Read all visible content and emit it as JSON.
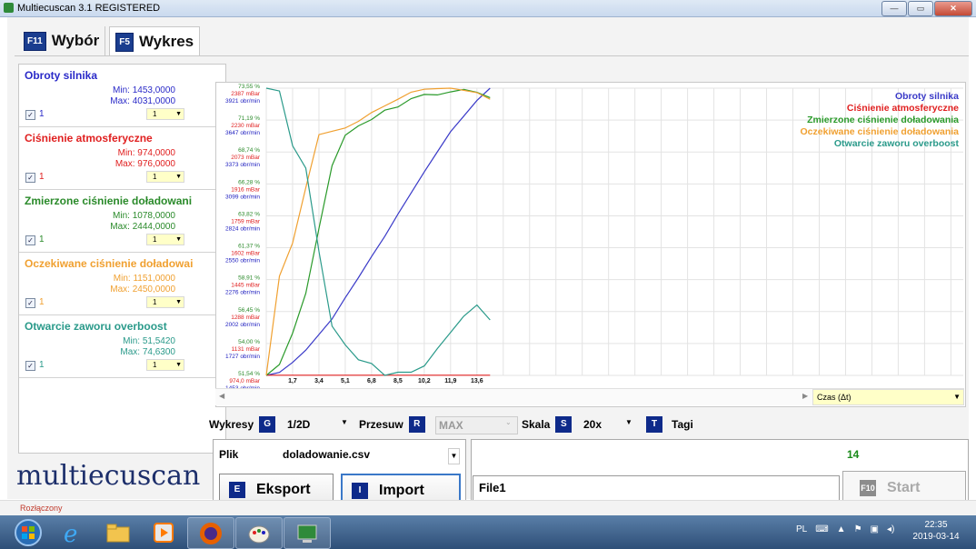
{
  "window": {
    "title": "Multiecuscan 3.1 REGISTERED",
    "buttons": [
      "—",
      "▭",
      "✕"
    ]
  },
  "tabs": [
    {
      "key": "F11",
      "label": "Wybór"
    },
    {
      "key": "F5",
      "label": "Wykres"
    }
  ],
  "channels": [
    {
      "name": "Obroty silnika",
      "color": "#2a2ac8",
      "min": "Min: 1453,0000",
      "max": "Max: 4031,0000",
      "checked": true,
      "value": "1",
      "select": "1"
    },
    {
      "name": "Ciśnienie atmosferyczne",
      "color": "#e02020",
      "min": "Min: 974,0000",
      "max": "Max: 976,0000",
      "checked": true,
      "value": "1",
      "select": "1"
    },
    {
      "name": "Zmierzone ciśnienie doładowani",
      "color": "#2a8a2a",
      "min": "Min: 1078,0000",
      "max": "Max: 2444,0000",
      "checked": true,
      "value": "1",
      "select": "1"
    },
    {
      "name": "Oczekiwane ciśnienie doładowai",
      "color": "#f0a030",
      "min": "Min: 1151,0000",
      "max": "Max: 2450,0000",
      "checked": true,
      "value": "1",
      "select": "1"
    },
    {
      "name": "Otwarcie zaworu overboost",
      "color": "#2a9a8a",
      "min": "Min: 51,5420",
      "max": "Max: 74,6300",
      "checked": true,
      "value": "1",
      "select": "1"
    }
  ],
  "logo": "multiecuscan",
  "chart_data": {
    "type": "line",
    "x": [
      0.0,
      0.85,
      1.7,
      2.55,
      3.4,
      4.25,
      5.1,
      5.95,
      6.8,
      7.65,
      8.5,
      9.35,
      10.2,
      11.05,
      11.9,
      12.75,
      13.6,
      14.45
    ],
    "xticks": [
      "1,7",
      "3,4",
      "5,1",
      "6,8",
      "8,5",
      "10,2",
      "11,9",
      "13,6"
    ],
    "xlim": [
      0,
      45
    ],
    "series": [
      {
        "name": "Obroty silnika",
        "color": "#3a3ac8",
        "values": [
          1453,
          1480,
          1570,
          1680,
          1820,
          1960,
          2150,
          2330,
          2520,
          2700,
          2900,
          3090,
          3280,
          3460,
          3640,
          3780,
          3920,
          4031
        ]
      },
      {
        "name": "Ciśnienie atmosferyczne",
        "color": "#e02020",
        "values": [
          975,
          975,
          975,
          975,
          975,
          975,
          975,
          975,
          975,
          975,
          975,
          975,
          975,
          975,
          975,
          975,
          975,
          975
        ]
      },
      {
        "name": "Zmierzone ciśnienie doładowania",
        "color": "#2a9a2a",
        "values": [
          1078,
          1130,
          1280,
          1470,
          1780,
          2080,
          2225,
          2270,
          2300,
          2345,
          2360,
          2400,
          2420,
          2418,
          2432,
          2444,
          2430,
          2405
        ]
      },
      {
        "name": "Oczekiwane ciśnienie doładowania",
        "color": "#f0a030",
        "values": [
          1151,
          1600,
          1750,
          2000,
          2240,
          2255,
          2270,
          2300,
          2340,
          2370,
          2400,
          2432,
          2445,
          2448,
          2450,
          2440,
          2430,
          2400
        ]
      },
      {
        "name": "Otwarcie zaworu overboost",
        "color": "#2a9a8a",
        "values": [
          74.63,
          74.4,
          70.0,
          68.2,
          61.5,
          55.5,
          54.0,
          52.8,
          52.5,
          51.542,
          51.8,
          51.8,
          52.3,
          53.7,
          55.0,
          56.3,
          57.2,
          56.0
        ]
      }
    ],
    "yaxis_labels": [
      [
        "73,55 %",
        "2387 mBar",
        "3921 obr/min"
      ],
      [
        "71,19 %",
        "2230 mBar",
        "3647 obr/min"
      ],
      [
        "68,74 %",
        "2073 mBar",
        "3373 obr/min"
      ],
      [
        "66,28 %",
        "1916 mBar",
        "3099 obr/min"
      ],
      [
        "63,82 %",
        "1759 mBar",
        "2824 obr/min"
      ],
      [
        "61,37 %",
        "1602 mBar",
        "2550 obr/min"
      ],
      [
        "58,91 %",
        "1445 mBar",
        "2276 obr/min"
      ],
      [
        "56,45 %",
        "1288 mBar",
        "2002 obr/min"
      ],
      [
        "54,00 %",
        "1131 mBar",
        "1727 obr/min"
      ],
      [
        "51,54 %",
        "974,0 mBar",
        "1453 obr/min"
      ]
    ],
    "legend_position": "top-right",
    "grid": true
  },
  "scroll": {
    "time_label": "Czas (Δt)"
  },
  "controls": {
    "wykresy": "Wykresy",
    "g_key": "G",
    "mode": "1/2D",
    "przesuw": "Przesuw",
    "r_key": "R",
    "przesuw_value": "MAX",
    "skala": "Skala",
    "s_key": "S",
    "skala_value": "20x",
    "t_key": "T",
    "tagi": "Tagi"
  },
  "file": {
    "label": "Plik",
    "filename": "doladowanie.csv"
  },
  "buttons": {
    "export_key": "E",
    "export": "Eksport",
    "import_key": "I",
    "import": "Import",
    "start_key": "F10",
    "start": "Start"
  },
  "count": "14",
  "file_entry": "File1",
  "status": "Rozłączony",
  "taskbar": {
    "lang": "PL",
    "time": "22:35",
    "date": "2019-03-14"
  }
}
